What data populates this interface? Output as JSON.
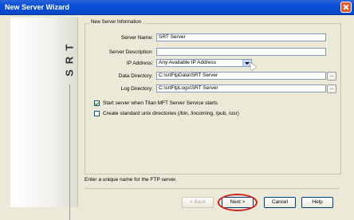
{
  "window": {
    "title": "New Server Wizard"
  },
  "brand": {
    "letters": [
      "T",
      "R",
      "S"
    ]
  },
  "group": {
    "legend": "New Server Information"
  },
  "fields": {
    "server_name": {
      "label": "Server Name:",
      "value": "SRT Server"
    },
    "server_description": {
      "label": "Server Description:",
      "value": ""
    },
    "ip_address": {
      "label": "IP Address:",
      "value": "Any Available IP Address"
    },
    "data_directory": {
      "label": "Data Directory:",
      "value": "C:\\srtFtpData\\SRT Server",
      "browse": "..."
    },
    "log_directory": {
      "label": "Log Directory:",
      "value": "C:\\srtFtpLogs\\SRT Server",
      "browse": "..."
    }
  },
  "options": {
    "start_service": {
      "label": "Start server when Titan MFT Server Service starts",
      "checked": true
    },
    "unix_dirs": {
      "label": "Create standard unix directories (/bin, /incoming, /pub, /usr)",
      "checked": false
    }
  },
  "hint": "Enter a unique name for the FTP server.",
  "buttons": {
    "back": "< Back",
    "next": "Next >",
    "cancel": "Cancel",
    "help": "Help"
  }
}
